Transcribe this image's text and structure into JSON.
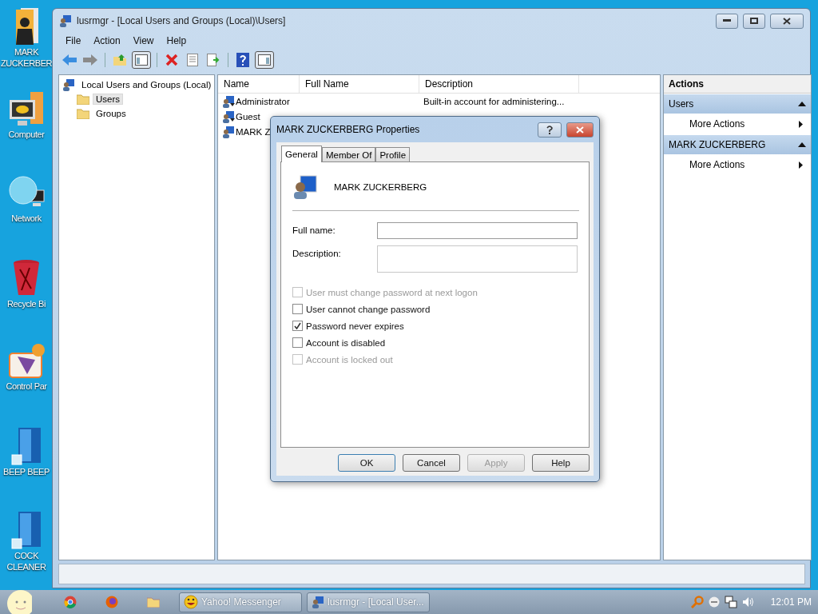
{
  "desktop_icons": [
    {
      "kind": "person",
      "label": "MARK ZUCKERBER"
    },
    {
      "kind": "computer",
      "label": "Computer"
    },
    {
      "kind": "network",
      "label": "Network"
    },
    {
      "kind": "bin",
      "label": "Recycle Bi"
    },
    {
      "kind": "panel",
      "label": "Control Par"
    },
    {
      "kind": "box",
      "label": "BEEP BEEP"
    },
    {
      "kind": "box",
      "label": "COCK CLEANER"
    }
  ],
  "window": {
    "title": "lusrmgr - [Local Users and Groups (Local)\\Users]",
    "menu": [
      "File",
      "Action",
      "View",
      "Help"
    ]
  },
  "tree": [
    {
      "label": "Local Users and Groups (Local)",
      "children": [
        {
          "label": "Users",
          "selected": true
        },
        {
          "label": "Groups",
          "selected": false
        }
      ]
    }
  ],
  "list": {
    "columns": [
      "Name",
      "Full Name",
      "Description"
    ],
    "rows": [
      {
        "kind": "builtin",
        "name": "Administrator",
        "description": "Built-in account for administering..."
      },
      {
        "kind": "builtin",
        "name": "Guest"
      },
      {
        "kind": "user",
        "name": "MARK Z"
      }
    ]
  },
  "actions": {
    "title": "Actions",
    "sections": [
      {
        "title": "Users",
        "expanded": true,
        "items": [
          "More Actions"
        ]
      },
      {
        "title": "MARK ZUCKERBERG",
        "expanded": true,
        "items": [
          "More Actions"
        ]
      }
    ]
  },
  "dialog": {
    "title": "MARK ZUCKERBERG Properties",
    "tabs": [
      {
        "label": "General",
        "selected": true
      },
      {
        "label": "Member Of",
        "selected": false
      },
      {
        "label": "Profile",
        "selected": false
      }
    ],
    "user_name": "MARK ZUCKERBERG",
    "fields": [
      {
        "kind": "single",
        "label": "Full name:"
      },
      {
        "kind": "multi",
        "label": "Description:"
      }
    ],
    "options": [
      {
        "label": "User must change password at next logon",
        "checked": false,
        "disabled": true
      },
      {
        "label": "User cannot change password",
        "checked": false,
        "disabled": false
      },
      {
        "label": "Password never expires",
        "checked": true,
        "disabled": false
      },
      {
        "label": "Account is disabled",
        "checked": false,
        "disabled": false
      },
      {
        "label": "Account is locked out",
        "checked": false,
        "disabled": true
      }
    ],
    "buttons": [
      {
        "label": "OK",
        "default": true,
        "disabled": false
      },
      {
        "label": "Cancel",
        "default": false,
        "disabled": false
      },
      {
        "label": "Apply",
        "default": false,
        "disabled": true
      },
      {
        "label": "Help",
        "default": false,
        "disabled": false
      }
    ]
  },
  "taskbar": {
    "tasks": [
      {
        "kind": "messenger",
        "label": "Yahoo! Messenger"
      },
      {
        "kind": "users",
        "label": "lusrmgr - [Local User..."
      }
    ],
    "clock": "12:01 PM"
  }
}
